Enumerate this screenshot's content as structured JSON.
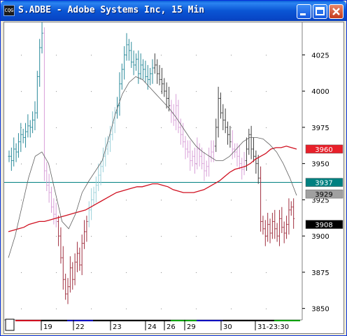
{
  "window": {
    "title": "S.ADBE - Adobe Systems Inc, 15 Min",
    "icon_name": "chart-window-icon",
    "icon_text": "CQG"
  },
  "chart_data": {
    "type": "candlestick",
    "symbol": "S.ADBE",
    "interval": "15 Min",
    "ylim": [
      3845,
      4045
    ],
    "y_ticks": [
      3850,
      3875,
      3900,
      3925,
      3950,
      3975,
      4000,
      4025
    ],
    "x_ticks": [
      "19",
      "22",
      "23",
      "24",
      "26",
      "29",
      "30",
      "31-23:30"
    ],
    "price_labels": [
      {
        "value": 3960,
        "text": "3960",
        "color": "#e8202a",
        "text_color": "#ffffff"
      },
      {
        "value": 3937,
        "text": "3937",
        "color": "#008080",
        "text_color": "#ffffff"
      },
      {
        "value": 3929,
        "text": "3929",
        "color": "#a0a0a0",
        "text_color": "#000000"
      },
      {
        "value": 3908,
        "text": "3908",
        "color": "#000000",
        "text_color": "#ffffff"
      }
    ],
    "hline": 3937,
    "colors": {
      "up_rising": "#2a8a9a",
      "up_light": "#9bd0da",
      "down_light": "#d8a0d8",
      "down_dark": "#a03040",
      "neutral": "#404040",
      "long_ma": "#d01020",
      "short_ma": "#606060",
      "hline": "#008080"
    },
    "series": [
      {
        "name": "segment-1",
        "color": "#2a8a9a",
        "values": [
          3955,
          3952,
          3960,
          3958,
          3965,
          3970,
          3968,
          3972,
          3976,
          3975,
          3980,
          3985,
          4010,
          4030,
          4040
        ]
      },
      {
        "name": "segment-2",
        "color": "#d8a0d8",
        "values": [
          3945,
          3935,
          3930,
          3920,
          3915,
          3910
        ]
      },
      {
        "name": "segment-3",
        "color": "#a03040",
        "values": [
          3900,
          3885,
          3870,
          3860,
          3865,
          3878,
          3870,
          3882,
          3888,
          3880,
          3895,
          3903,
          3910
        ]
      },
      {
        "name": "segment-4",
        "color": "#9bd0da",
        "values": [
          3918,
          3925,
          3930,
          3935,
          3942,
          3948,
          3955,
          3960,
          3965,
          3970,
          3978,
          3985
        ]
      },
      {
        "name": "segment-5",
        "color": "#2a8a9a",
        "values": [
          3990,
          4005,
          4015,
          4025,
          4032,
          4028,
          4020,
          4018,
          4022,
          4012,
          4018,
          4015,
          4010,
          4008,
          4012,
          4016
        ]
      },
      {
        "name": "segment-6",
        "color": "#404040",
        "values": [
          4018,
          4012,
          4008,
          4005,
          4000,
          3995,
          3990
        ]
      },
      {
        "name": "segment-7",
        "color": "#d8a0d8",
        "values": [
          3985,
          3980,
          3990,
          3975,
          3970,
          3965,
          3960,
          3958,
          3952,
          3955,
          3950,
          3960,
          3955,
          3950,
          3945,
          3948,
          3955,
          3958,
          3962
        ]
      },
      {
        "name": "segment-8",
        "color": "#404040",
        "values": [
          3975,
          3995,
          3985,
          3980,
          3975,
          3970,
          3965
        ]
      },
      {
        "name": "segment-9",
        "color": "#d8a0d8",
        "values": [
          3960,
          3958,
          3955,
          3950,
          3946,
          3952
        ]
      },
      {
        "name": "segment-10",
        "color": "#404040",
        "values": [
          3960,
          3970,
          3960,
          3955,
          3950,
          3940
        ]
      },
      {
        "name": "segment-11",
        "color": "#a03040",
        "values": [
          3910,
          3905,
          3900,
          3908,
          3902,
          3910,
          3905,
          3900,
          3912,
          3906,
          3902,
          3908,
          3918,
          3920,
          3912
        ]
      }
    ],
    "long_ma": [
      3903,
      3904,
      3905,
      3906,
      3908,
      3909,
      3910,
      3910,
      3911,
      3912,
      3913,
      3914,
      3915,
      3916,
      3917,
      3918,
      3920,
      3922,
      3924,
      3926,
      3928,
      3930,
      3931,
      3932,
      3933,
      3934,
      3934,
      3935,
      3936,
      3936,
      3935,
      3934,
      3932,
      3931,
      3930,
      3930,
      3930,
      3931,
      3932,
      3934,
      3936,
      3938,
      3941,
      3944,
      3946,
      3947,
      3948,
      3950,
      3953,
      3955,
      3957,
      3960,
      3961,
      3961,
      3962,
      3961,
      3960
    ],
    "short_ma": [
      3885,
      3900,
      3920,
      3940,
      3955,
      3958,
      3950,
      3930,
      3910,
      3905,
      3915,
      3930,
      3938,
      3945,
      3952,
      3968,
      3985,
      3998,
      4006,
      4010,
      4008,
      4003,
      3998,
      3993,
      3988,
      3982,
      3975,
      3968,
      3962,
      3958,
      3955,
      3952,
      3952,
      3955,
      3960,
      3965,
      3968,
      3968,
      3967,
      3963,
      3958,
      3950,
      3940,
      3928
    ]
  }
}
